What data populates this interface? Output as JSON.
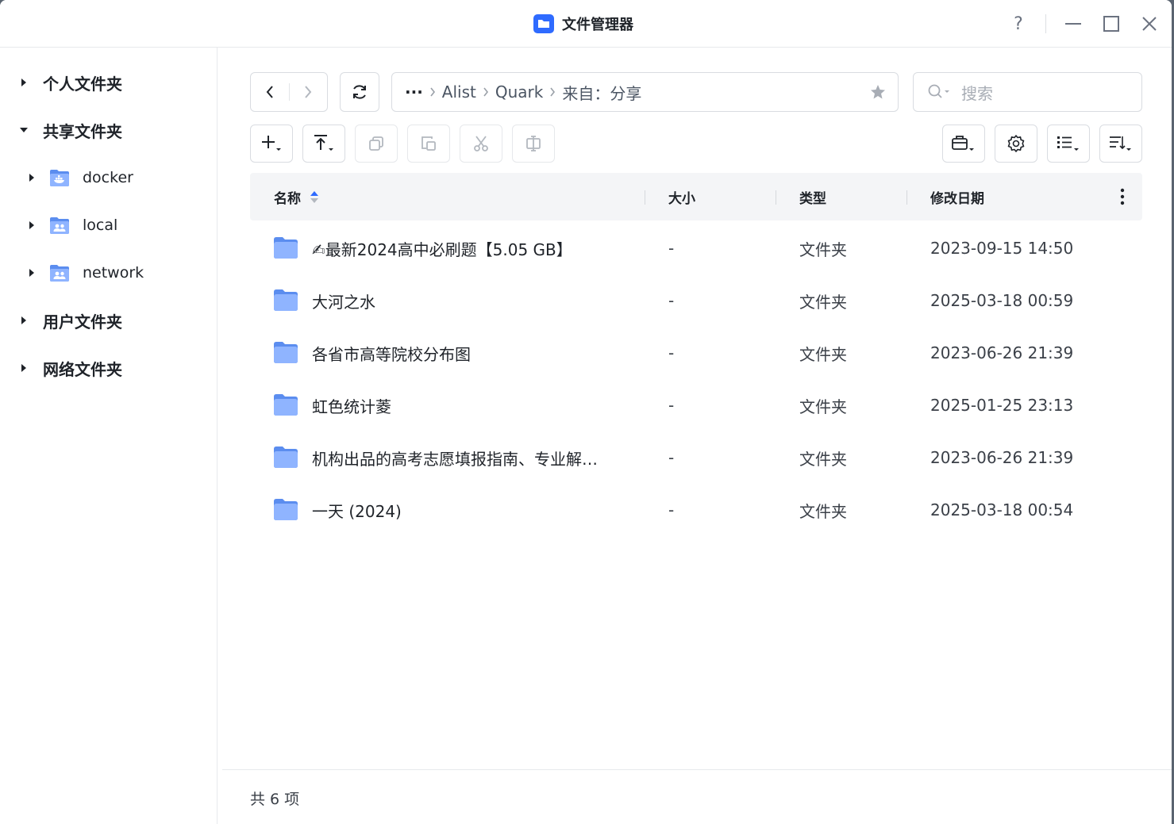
{
  "window": {
    "title": "文件管理器",
    "controls": {
      "help": "?",
      "minimize": "—",
      "maximize": "□",
      "close": "✕"
    }
  },
  "sidebar": {
    "sections": [
      {
        "label": "个人文件夹",
        "expanded": false
      },
      {
        "label": "共享文件夹",
        "expanded": true,
        "children": [
          {
            "label": "docker",
            "icon": "docker-folder-icon"
          },
          {
            "label": "local",
            "icon": "shared-folder-icon"
          },
          {
            "label": "network",
            "icon": "shared-folder-icon"
          }
        ]
      },
      {
        "label": "用户文件夹",
        "expanded": false
      },
      {
        "label": "网络文件夹",
        "expanded": false
      }
    ]
  },
  "toolbar": {
    "breadcrumb": {
      "more": "···",
      "items": [
        "Alist",
        "Quark",
        "来自：分享"
      ]
    },
    "search": {
      "placeholder": "搜索"
    }
  },
  "table": {
    "columns": {
      "name": "名称",
      "size": "大小",
      "type": "类型",
      "modified": "修改日期"
    },
    "rows": [
      {
        "name": "✍最新2024高中必刷题【5.05 GB】",
        "size": "-",
        "type": "文件夹",
        "modified": "2023-09-15 14:50"
      },
      {
        "name": "大河之水",
        "size": "-",
        "type": "文件夹",
        "modified": "2025-03-18 00:59"
      },
      {
        "name": "各省市高等院校分布图",
        "size": "-",
        "type": "文件夹",
        "modified": "2023-06-26 21:39"
      },
      {
        "name": "虹色统计菱",
        "size": "-",
        "type": "文件夹",
        "modified": "2025-01-25 23:13"
      },
      {
        "name": "机构出品的高考志愿填报指南、专业解…",
        "size": "-",
        "type": "文件夹",
        "modified": "2023-06-26 21:39"
      },
      {
        "name": "一天 (2024)",
        "size": "-",
        "type": "文件夹",
        "modified": "2025-03-18 00:54"
      }
    ]
  },
  "footer": {
    "count": "共 6 项"
  },
  "colors": {
    "accent": "#2f6bff",
    "folder": "#5b8def",
    "folder_light": "#8fb4ff"
  }
}
